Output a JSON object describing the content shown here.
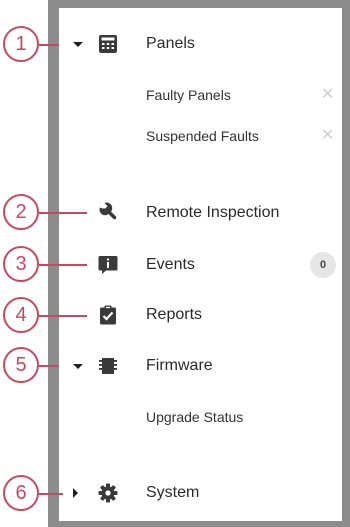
{
  "callouts": [
    "1",
    "2",
    "3",
    "4",
    "5",
    "6"
  ],
  "menu": {
    "panels": {
      "label": "Panels",
      "icon": "calculator-icon",
      "expanded": true,
      "children": [
        {
          "label": "Faulty Panels",
          "clear": "✕"
        },
        {
          "label": "Suspended Faults",
          "clear": "✕"
        }
      ]
    },
    "remote_inspection": {
      "label": "Remote Inspection",
      "icon": "wrench-icon"
    },
    "events": {
      "label": "Events",
      "icon": "info-icon",
      "badge": "0"
    },
    "reports": {
      "label": "Reports",
      "icon": "clipboard-check-icon"
    },
    "firmware": {
      "label": "Firmware",
      "icon": "chip-icon",
      "expanded": true,
      "children": [
        {
          "label": "Upgrade Status"
        }
      ]
    },
    "system": {
      "label": "System",
      "icon": "gear-icon",
      "expanded": false
    }
  },
  "colors": {
    "callout": "#c8485f",
    "frame": "#8c8c8c",
    "icon": "#3a3a3a",
    "badge_bg": "#e6e6e6"
  }
}
